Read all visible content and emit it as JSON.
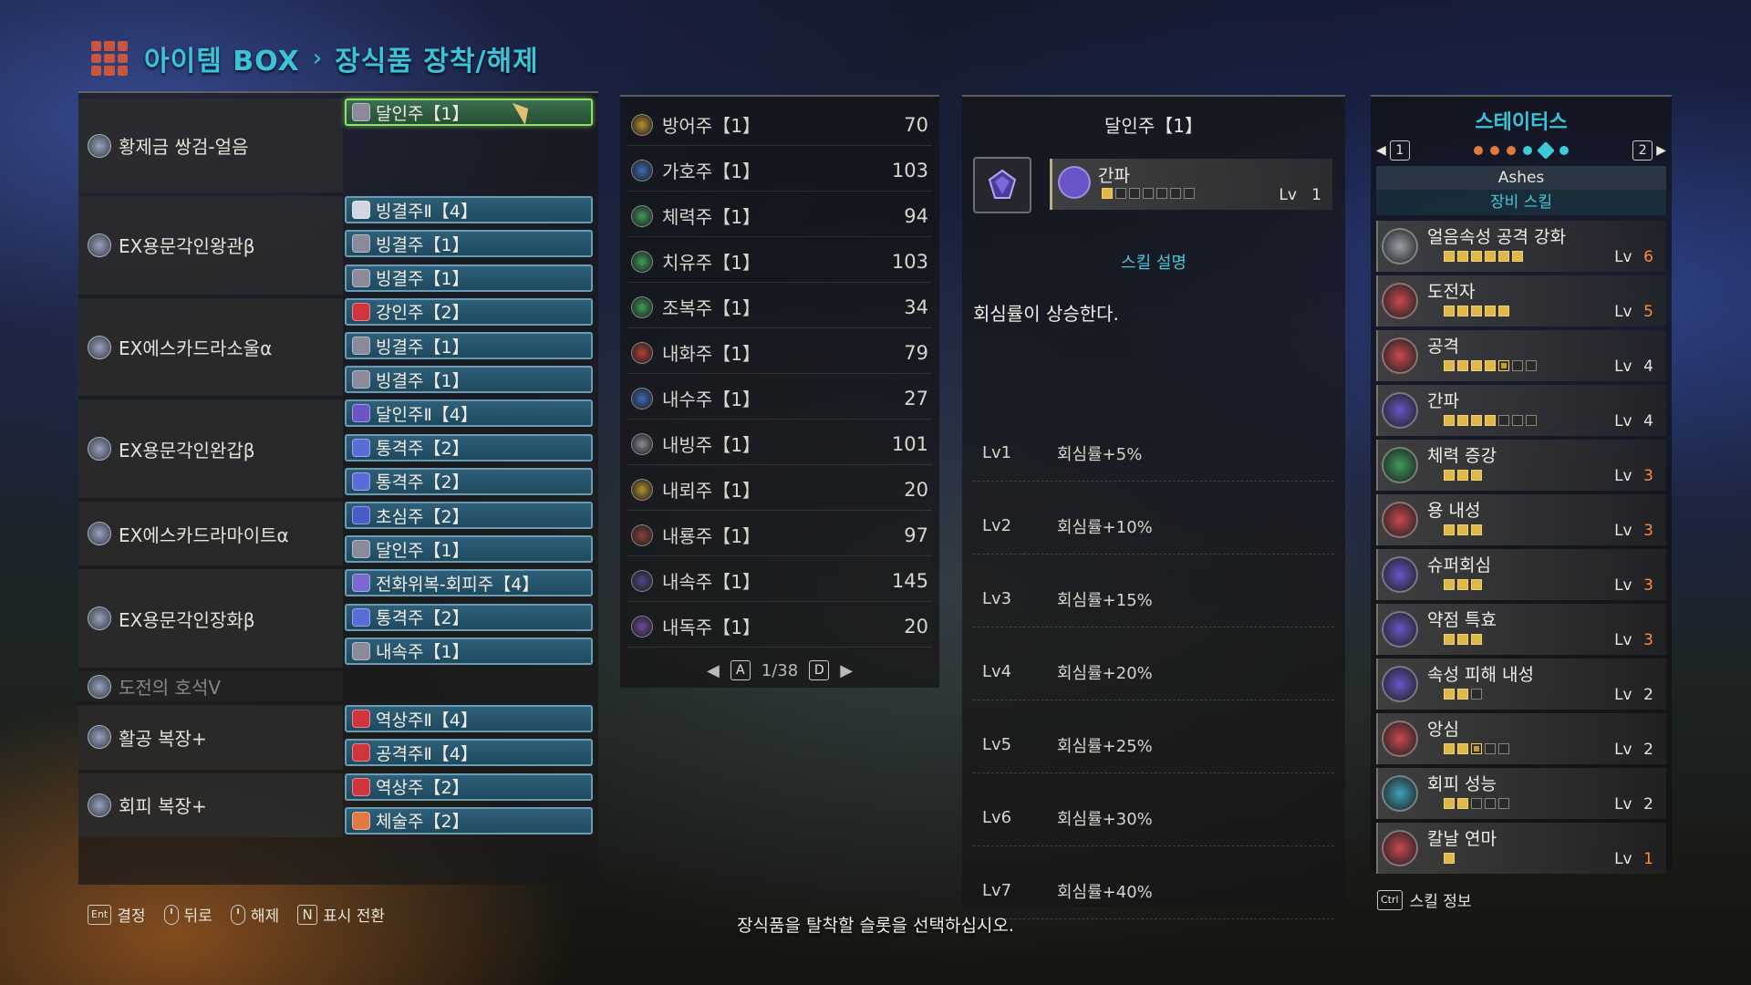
{
  "title": {
    "part1": "아이템 BOX",
    "separator": "›",
    "part2": "장식품 장착/해제"
  },
  "equipment": [
    {
      "name": "황제금 쌍검-얼음",
      "slots": [
        {
          "label": "달인주【1】",
          "color": "#8a8a9a",
          "selected": true
        }
      ]
    },
    {
      "name": "EX용문각인왕관β",
      "slots": [
        {
          "label": "빙결주Ⅱ【4】",
          "color": "#cfd6e2"
        },
        {
          "label": "빙결주【1】",
          "color": "#8a8a9a"
        },
        {
          "label": "빙결주【1】",
          "color": "#8a8a9a"
        }
      ]
    },
    {
      "name": "EX에스카드라소울α",
      "slots": [
        {
          "label": "강인주【2】",
          "color": "#d0343c"
        },
        {
          "label": "빙결주【1】",
          "color": "#8a8a9a"
        },
        {
          "label": "빙결주【1】",
          "color": "#8a8a9a"
        }
      ]
    },
    {
      "name": "EX용문각인완갑β",
      "slots": [
        {
          "label": "달인주Ⅱ【4】",
          "color": "#6a54c8"
        },
        {
          "label": "통격주【2】",
          "color": "#5a6cd8"
        },
        {
          "label": "통격주【2】",
          "color": "#5a6cd8"
        }
      ]
    },
    {
      "name": "EX에스카드라마이트α",
      "slots": [
        {
          "label": "초심주【2】",
          "color": "#4a5cc8"
        },
        {
          "label": "달인주【1】",
          "color": "#8a8a9a"
        }
      ]
    },
    {
      "name": "EX용문각인장화β",
      "slots": [
        {
          "label": "전화위복-회피주【4】",
          "color": "#7a6ad0"
        },
        {
          "label": "통격주【2】",
          "color": "#5a6cd8"
        },
        {
          "label": "내속주【1】",
          "color": "#8a8a9a"
        }
      ]
    },
    {
      "name": "도전의 호석Ⅴ",
      "dim": true,
      "slots": []
    },
    {
      "name": "활공 복장+",
      "slots": [
        {
          "label": "역상주Ⅱ【4】",
          "color": "#d0343c"
        },
        {
          "label": "공격주Ⅱ【4】",
          "color": "#d0343c"
        }
      ]
    },
    {
      "name": "회피 복장+",
      "slots": [
        {
          "label": "역상주【2】",
          "color": "#d0343c"
        },
        {
          "label": "체술주【2】",
          "color": "#e07a40"
        }
      ]
    }
  ],
  "decorations": [
    {
      "name": "방어주【1】",
      "count": "70",
      "color": "#b8902e"
    },
    {
      "name": "가호주【1】",
      "count": "103",
      "color": "#3e6ab8"
    },
    {
      "name": "체력주【1】",
      "count": "94",
      "color": "#3e9a5a"
    },
    {
      "name": "치유주【1】",
      "count": "103",
      "color": "#3e9a5a"
    },
    {
      "name": "조복주【1】",
      "count": "34",
      "color": "#3e9a5a"
    },
    {
      "name": "내화주【1】",
      "count": "79",
      "color": "#b83e3e"
    },
    {
      "name": "내수주【1】",
      "count": "27",
      "color": "#3e6ab8"
    },
    {
      "name": "내빙주【1】",
      "count": "101",
      "color": "#8a8a9a"
    },
    {
      "name": "내뢰주【1】",
      "count": "20",
      "color": "#b8902e"
    },
    {
      "name": "내룡주【1】",
      "count": "97",
      "color": "#8a3e3e"
    },
    {
      "name": "내속주【1】",
      "count": "145",
      "color": "#4a4a8a"
    },
    {
      "name": "내독주【1】",
      "count": "20",
      "color": "#6a4a9a"
    }
  ],
  "pager": {
    "left_key": "A",
    "page": "1/38",
    "right_key": "D"
  },
  "detail": {
    "title": "달인주【1】",
    "skill_name": "간파",
    "skill_level_label": "Lv",
    "skill_level": "1",
    "desc_heading": "스킬 설명",
    "description": "회심률이 상승한다.",
    "levels": [
      {
        "lv": "Lv1",
        "effect": "회심률+5%"
      },
      {
        "lv": "Lv2",
        "effect": "회심률+10%"
      },
      {
        "lv": "Lv3",
        "effect": "회심률+15%"
      },
      {
        "lv": "Lv4",
        "effect": "회심률+20%"
      },
      {
        "lv": "Lv5",
        "effect": "회심률+25%"
      },
      {
        "lv": "Lv6",
        "effect": "회심률+30%"
      },
      {
        "lv": "Lv7",
        "effect": "회심률+40%"
      }
    ]
  },
  "status": {
    "title": "스테이터스",
    "set_left": "1",
    "set_right": "2",
    "set_name": "Ashes",
    "equip_skill_heading": "장비 스킬",
    "skills": [
      {
        "name": "얼음속성 공격 강화",
        "lv": "6",
        "filled": 6,
        "max": 6,
        "bonus": 0,
        "color": "#9aa0aa",
        "highlight": true
      },
      {
        "name": "도전자",
        "lv": "5",
        "filled": 5,
        "max": 5,
        "bonus": 0,
        "color": "#c84850",
        "highlight": true
      },
      {
        "name": "공격",
        "lv": "4",
        "filled": 4,
        "max": 7,
        "bonus": 1,
        "color": "#c84850",
        "highlight": false
      },
      {
        "name": "간파",
        "lv": "4",
        "filled": 4,
        "max": 7,
        "bonus": 0,
        "color": "#6a54c8",
        "highlight": false
      },
      {
        "name": "체력 증강",
        "lv": "3",
        "filled": 3,
        "max": 3,
        "bonus": 0,
        "color": "#3e9a5a",
        "highlight": true
      },
      {
        "name": "용 내성",
        "lv": "3",
        "filled": 3,
        "max": 3,
        "bonus": 0,
        "color": "#c84850",
        "highlight": true
      },
      {
        "name": "슈퍼회심",
        "lv": "3",
        "filled": 3,
        "max": 3,
        "bonus": 0,
        "color": "#6a54c8",
        "highlight": true
      },
      {
        "name": "약점 특효",
        "lv": "3",
        "filled": 3,
        "max": 3,
        "bonus": 0,
        "color": "#6a54c8",
        "highlight": true
      },
      {
        "name": "속성 피해 내성",
        "lv": "2",
        "filled": 2,
        "max": 3,
        "bonus": 0,
        "color": "#6a54c8",
        "highlight": false
      },
      {
        "name": "앙심",
        "lv": "2",
        "filled": 2,
        "max": 5,
        "bonus": 1,
        "color": "#c84850",
        "highlight": false
      },
      {
        "name": "회피 성능",
        "lv": "2",
        "filled": 2,
        "max": 5,
        "bonus": 0,
        "color": "#3ea0b8",
        "highlight": false
      },
      {
        "name": "칼날 연마",
        "lv": "1",
        "filled": 1,
        "max": 1,
        "bonus": 0,
        "color": "#c84850",
        "highlight": true
      }
    ],
    "ctrl_key": "Ctrl",
    "skill_info": "스킬 정보"
  },
  "controls": [
    {
      "key": "Ent",
      "label": "결정"
    },
    {
      "key": "mouse",
      "label": "뒤로"
    },
    {
      "key": "mouse",
      "label": "해제"
    },
    {
      "key": "N",
      "label": "표시 전환"
    }
  ],
  "hint": "장식품을 탈착할 슬롯을 선택하십시오."
}
